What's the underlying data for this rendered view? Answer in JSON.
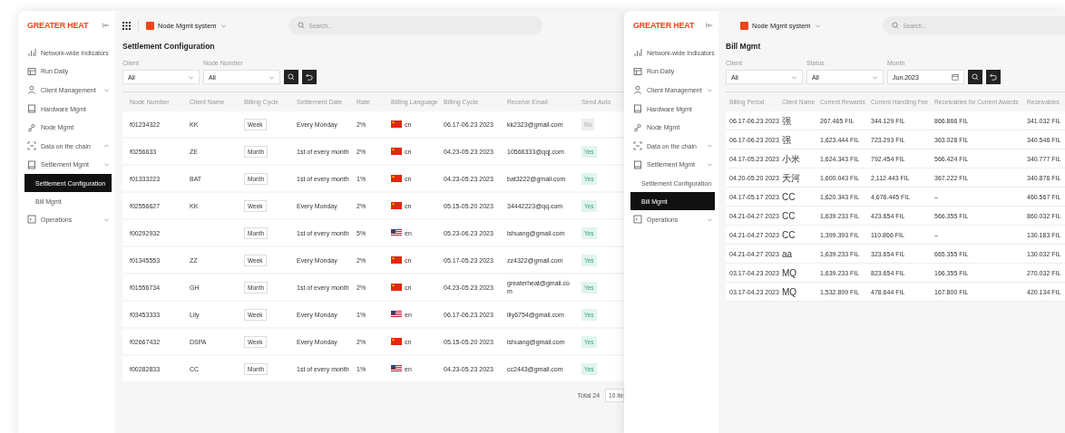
{
  "windows": [
    {
      "logo": "GREATER HEAT",
      "system": "Node Mgmt system",
      "search": {
        "placeholder": "Search..."
      },
      "sidebar": {
        "items": [
          {
            "label": "Network-wide Indicators",
            "selected": false
          },
          {
            "label": "Run Daily",
            "selected": false
          },
          {
            "label": "Client Management",
            "selected": false,
            "expanded": false
          },
          {
            "label": "Hardware Mgmt",
            "selected": false
          },
          {
            "label": "Node Mgmt",
            "selected": false
          },
          {
            "label": "Data on the chain",
            "selected": false,
            "expanded": true
          },
          {
            "label": "Settlement Mgmt",
            "selected": false,
            "expanded": false,
            "children": [
              {
                "label": "Settlement Configuration",
                "selected": true
              },
              {
                "label": "Bill Mgmt",
                "selected": false
              }
            ]
          },
          {
            "label": "Operations",
            "selected": false,
            "expanded": false
          }
        ]
      },
      "title": "Settlement Configuration",
      "filters": [
        {
          "kind": "select",
          "label": "Client",
          "value": "All"
        },
        {
          "kind": "select",
          "label": "Node Number",
          "value": "All"
        }
      ],
      "table": {
        "columns": [
          "Node Number",
          "Client Name",
          "Billing Cycle",
          "Settlement Date",
          "Rate",
          "Billing Language",
          "Billing Cycle",
          "Receive Email",
          "Send Auto"
        ],
        "rows": [
          [
            "f01234322",
            "KK",
            {
              "kind": "tag",
              "text": "Week"
            },
            "Every Monday",
            "2%",
            {
              "kind": "chinese",
              "text": "cn"
            },
            "06.17-06.23 2023",
            "kk2323@gmail.com",
            {
              "kind": "status",
              "text": "No",
              "on": false
            }
          ],
          [
            "f0256633",
            "ZE",
            {
              "kind": "tag",
              "text": "Month"
            },
            "1st of every month",
            "2%",
            {
              "kind": "chinese",
              "text": "cn"
            },
            "04.23-05.23 2023",
            "10566333@qqj.com",
            {
              "kind": "status",
              "text": "Yes",
              "on": true
            }
          ],
          [
            "f01333223",
            "BAT",
            {
              "kind": "tag",
              "text": "Month"
            },
            "1st of every month",
            "1%",
            {
              "kind": "chinese",
              "text": "cn"
            },
            "04.23-05.23 2023",
            "bat3222@gmail.com",
            {
              "kind": "status",
              "text": "Yes",
              "on": true
            }
          ],
          [
            "f02556627",
            "KK",
            {
              "kind": "tag",
              "text": "Week"
            },
            "Every Monday",
            "2%",
            {
              "kind": "chinese",
              "text": "cn"
            },
            "05.15-05.20 2023",
            "34442223@qq.com",
            {
              "kind": "status",
              "text": "Yes",
              "on": true
            }
          ],
          [
            "f00292932",
            null,
            {
              "kind": "tag",
              "text": "Month"
            },
            "1st of every month",
            "5%",
            {
              "kind": "english",
              "text": "en"
            },
            "05.23-06.23 2023",
            "lshuang@gmail.com",
            {
              "kind": "status",
              "text": "Yes",
              "on": true
            }
          ],
          [
            "f01345553",
            "ZZ",
            {
              "kind": "tag",
              "text": "Week"
            },
            "Every Monday",
            "2%",
            {
              "kind": "chinese",
              "text": "cn"
            },
            "05.17-05.23 2023",
            "zz4322@gmail.com",
            {
              "kind": "status",
              "text": "Yes",
              "on": true
            }
          ],
          [
            "f01556734",
            "GH",
            {
              "kind": "tag",
              "text": "Month"
            },
            "1st of every month",
            "2%",
            {
              "kind": "chinese",
              "text": "cn"
            },
            "04.23-05.23 2023",
            "greaterheat@gmail.com",
            {
              "kind": "status",
              "text": "Yes",
              "on": true
            }
          ],
          [
            "f03453333",
            "Lily",
            {
              "kind": "tag",
              "text": "Week"
            },
            "Every Monday",
            "1%",
            {
              "kind": "english",
              "text": "en"
            },
            "06.17-06.23 2023",
            "lily6754@gmail.com",
            {
              "kind": "status",
              "text": "Yes",
              "on": true
            }
          ],
          [
            "f02667432",
            "DSPA",
            {
              "kind": "tag",
              "text": "Week"
            },
            "Every Monday",
            "2%",
            {
              "kind": "chinese",
              "text": "cn"
            },
            "05.15-05.20 2023",
            "lshuang@gmail.com",
            {
              "kind": "status",
              "text": "Yes",
              "on": true
            }
          ],
          [
            "f00282833",
            "CC",
            {
              "kind": "tag",
              "text": "Month"
            },
            "1st of every month",
            "1%",
            {
              "kind": "english",
              "text": "en"
            },
            "04.23-05.23 2023",
            "cc2443@gmail.com",
            {
              "kind": "status",
              "text": "Yes",
              "on": true
            }
          ]
        ]
      },
      "pagination": {
        "total": "Total 24",
        "page_size": "10 ite"
      }
    },
    {
      "logo": "GREATER HEAT",
      "system": "Node Mgmt system",
      "search": {
        "placeholder": "Search..."
      },
      "sidebar": {
        "items": [
          {
            "label": "Network-wide Indicators",
            "selected": false
          },
          {
            "label": "Run Daily",
            "selected": false
          },
          {
            "label": "Client Management",
            "selected": false,
            "expanded": false
          },
          {
            "label": "Hardware Mgmt",
            "selected": false
          },
          {
            "label": "Node Mgmt",
            "selected": false
          },
          {
            "label": "Data on the chain",
            "selected": false,
            "expanded": true
          },
          {
            "label": "Settlement Mgmt",
            "selected": false,
            "expanded": false,
            "children": [
              {
                "label": "Settlement Configuration",
                "selected": false
              },
              {
                "label": "Bill Mgmt",
                "selected": true
              }
            ]
          },
          {
            "label": "Operations",
            "selected": false,
            "expanded": false
          }
        ]
      },
      "title": "Bill Mgmt",
      "filters": [
        {
          "kind": "select",
          "label": "Client",
          "value": "All"
        },
        {
          "kind": "select",
          "label": "Status",
          "value": "All"
        },
        {
          "kind": "date",
          "label": "Month",
          "value": "Jun.2023"
        }
      ],
      "table": {
        "columns": [
          "Billing Period",
          "Client Name",
          "Current Rewards",
          "Current Handling Fee",
          "Receivables for Current Awards",
          "Receivables"
        ],
        "rows": [
          [
            "06.17-06.23 2023",
            "强",
            "267.465 FIL",
            "344.129 FIL",
            "866.866 FIL",
            "341.032 FIL"
          ],
          [
            "06.17-06.23 2023",
            "强",
            "1,623.444 FIL",
            "723.293 FIL",
            "363.028 FIL",
            "340.546 FIL"
          ],
          [
            "04.17-05.23 2023",
            "小米",
            "1,624.343 FIL",
            "792.454 FIL",
            "566.424 FIL",
            "340.777 FIL"
          ],
          [
            "04.20-05.20 2023",
            "天河",
            "1,600.043 FIL",
            "2,112.443 FIL",
            "367.222 FIL",
            "340.876 FIL"
          ],
          [
            "04.17-05.17 2023",
            "CC",
            "1,620.343 FIL",
            "4,676.445 FIL",
            "–",
            "460.567 FIL"
          ],
          [
            "04.21-04.27 2023",
            "CC",
            "1,639.233 FIL",
            "423.654 FIL",
            "566.355 FIL",
            "860.032 FIL"
          ],
          [
            "04.21-04.27 2023",
            "CC",
            "1,399.393 FIL",
            "110.866 FIL",
            "–",
            "130.183 FIL"
          ],
          [
            "04.21-04.27 2023",
            "aa",
            "1,639.233 FIL",
            "323.654 FIL",
            "665.355 FIL",
            "130.032 FIL"
          ],
          [
            "03.17-04.23 2023",
            "MQ",
            "1,639.233 FIL",
            "823.654 FIL",
            "166.355 FIL",
            "270.032 FIL"
          ],
          [
            "03.17-04.23 2023",
            "MQ",
            "1,532.899 FIL",
            "478.644 FIL",
            "167.800 FIL",
            "420.134 FIL"
          ]
        ]
      }
    }
  ]
}
